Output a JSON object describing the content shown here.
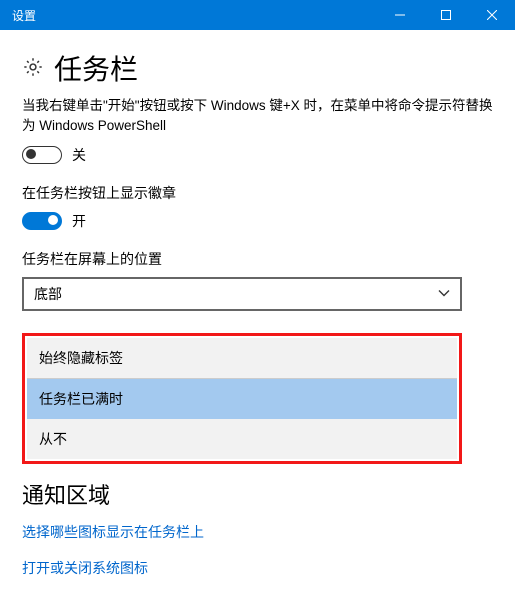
{
  "window": {
    "title": "设置"
  },
  "page": {
    "heading": "任务栏",
    "description": "当我右键单击\"开始\"按钮或按下 Windows 键+X 时，在菜单中将命令提示符替换为 Windows PowerShell"
  },
  "toggles": {
    "powershell": {
      "state": "off",
      "label": "关"
    },
    "badges": {
      "title": "在任务栏按钮上显示徽章",
      "state": "on",
      "label": "开"
    }
  },
  "position": {
    "label": "任务栏在屏幕上的位置",
    "value": "底部"
  },
  "combine": {
    "label": "始终隐藏标签",
    "options": [
      "任务栏已满时",
      "从不"
    ],
    "selected_index": 0
  },
  "notification": {
    "heading": "通知区域",
    "links": [
      "选择哪些图标显示在任务栏上",
      "打开或关闭系统图标"
    ]
  }
}
